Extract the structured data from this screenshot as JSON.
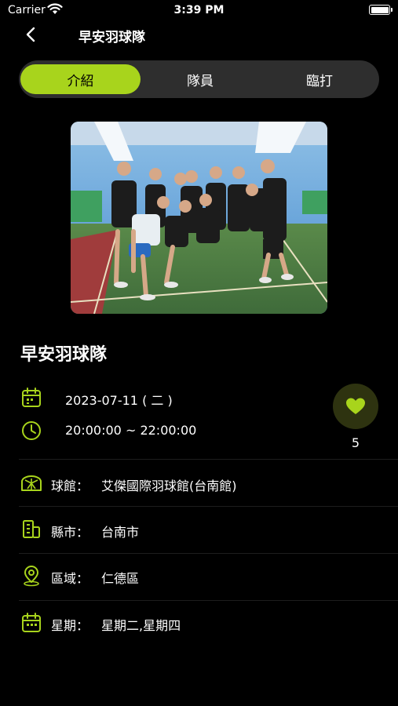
{
  "status_bar": {
    "carrier": "Carrier",
    "time": "3:39 PM"
  },
  "nav": {
    "title": "早安羽球隊"
  },
  "tabs": [
    {
      "label": "介紹",
      "active": true
    },
    {
      "label": "隊員",
      "active": false
    },
    {
      "label": "臨打",
      "active": false
    }
  ],
  "team": {
    "name": "早安羽球隊"
  },
  "schedule": {
    "date": "2023-07-11 ( 二 )",
    "time_range": "20:00:00 ~ 22:00:00"
  },
  "likes": {
    "count": "5"
  },
  "details": [
    {
      "icon": "stadium-icon",
      "label": "球館：",
      "value": "艾傑國際羽球館(台南館)"
    },
    {
      "icon": "building-icon",
      "label": "縣市：",
      "value": "台南市"
    },
    {
      "icon": "location-pin-icon",
      "label": "區域：",
      "value": "仁德區"
    },
    {
      "icon": "calendar-icon",
      "label": "星期：",
      "value": "星期二,星期四"
    }
  ],
  "colors": {
    "accent": "#a8d41c",
    "background": "#000000",
    "segment_bg": "#2e2e2e",
    "like_bg": "#2e3310"
  }
}
